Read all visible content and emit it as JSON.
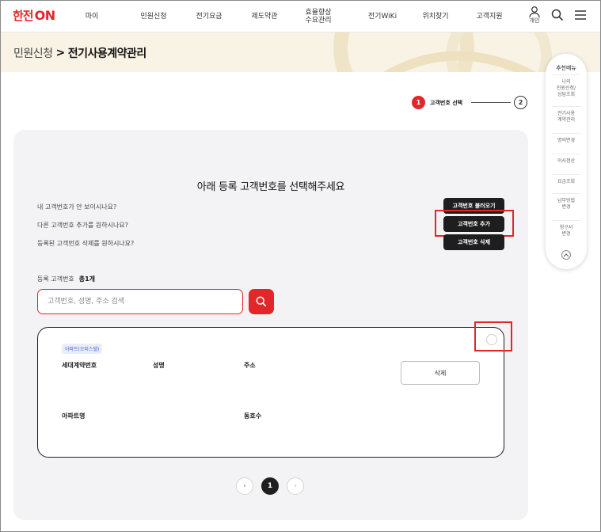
{
  "header": {
    "logo": {
      "text": "한전",
      "on": "ON"
    },
    "nav": [
      {
        "label": "마이"
      },
      {
        "label": "민원신청"
      },
      {
        "label": "전기요금"
      },
      {
        "label": "제도약관"
      },
      {
        "label_line1": "효율향상",
        "label_line2": "수요관리"
      },
      {
        "label": "전기WiKi"
      },
      {
        "label": "위치찾기"
      },
      {
        "label": "고객지원"
      }
    ],
    "user_label": "개인",
    "icons": [
      "user-icon",
      "search-icon",
      "menu-icon"
    ]
  },
  "breadcrumb": {
    "parent": "민원신청",
    "separator": ">",
    "current": "전기사용계약관리"
  },
  "steps": {
    "step1_num": "1",
    "step1_label": "고객번호 선택",
    "step2_num": "2"
  },
  "main": {
    "title": "아래 등록 고객번호를 선택해주세요",
    "questions": [
      {
        "text": "내 고객번호가 안 보이시나요?",
        "button": "고객번호 불러오기"
      },
      {
        "text": "다른 고객번호 추가를 원하시나요?",
        "button": "고객번호 추가"
      },
      {
        "text": "등록된 고객번호 삭제를 원하시나요?",
        "button": "고객번호 삭제"
      }
    ],
    "count_label": "등록 고객번호",
    "count_value": "총1개",
    "search_placeholder": "고객번호, 성명, 주소 검색",
    "item": {
      "badge": "아파트(오피스텔)",
      "fields": [
        "세대계약번호",
        "성명",
        "주소",
        "아파트명",
        "동호수"
      ],
      "delete_label": "삭제"
    },
    "pagination": {
      "prev": "‹",
      "current": "1",
      "next": "›"
    }
  },
  "quick_menu": {
    "title": "추천메뉴",
    "items": [
      {
        "line1": "나의",
        "line2": "민원신청/",
        "line3": "상담조회"
      },
      {
        "line1": "전기사용",
        "line2": "계약관리"
      },
      {
        "line1": "명의변경"
      },
      {
        "line1": "이사정산"
      },
      {
        "line1": "요금조회"
      },
      {
        "line1": "납부방법",
        "line2": "변경"
      },
      {
        "line1": "청구서",
        "line2": "변경"
      }
    ]
  },
  "colors": {
    "brand_red": "#e3262a",
    "dark_button": "#1e1e1e",
    "band": "#f8f3e5",
    "card": "#f3f3f5"
  }
}
